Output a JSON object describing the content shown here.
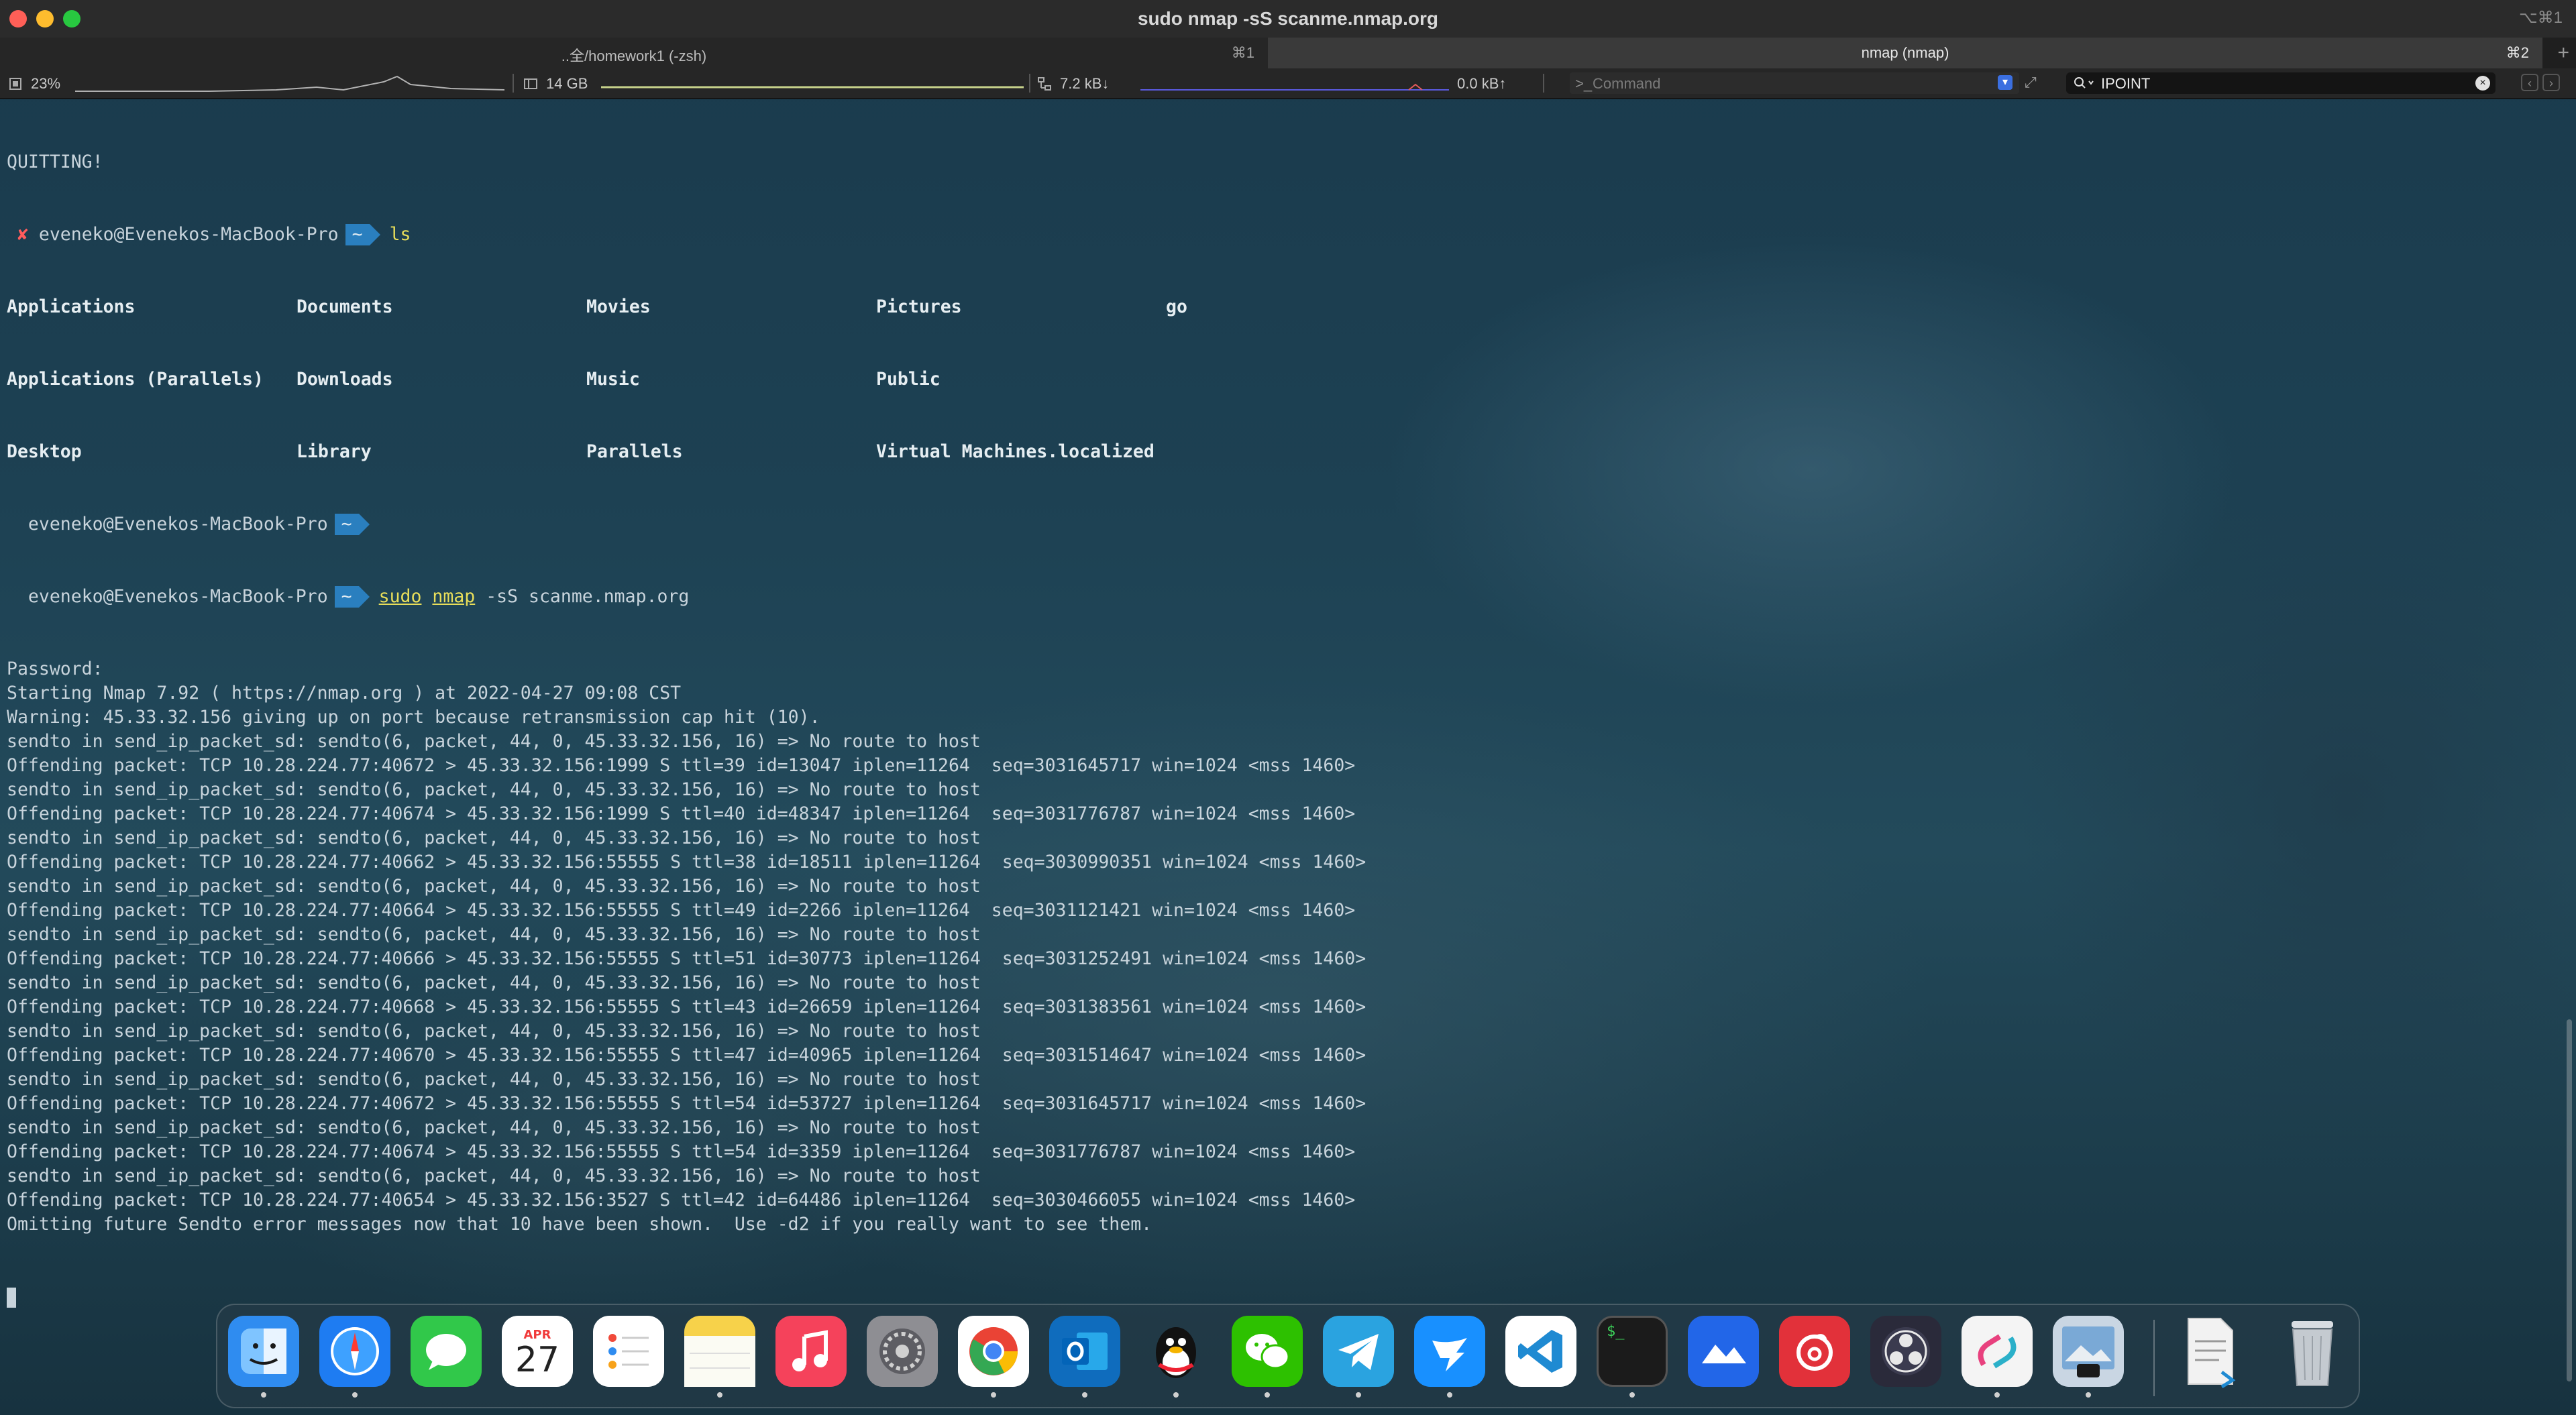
{
  "window": {
    "title": "sudo nmap -sS scanme.nmap.org",
    "shortcut": "⌥⌘1"
  },
  "tabs": [
    {
      "label": "..全/homework1 (-zsh)",
      "shortcut": "⌘1"
    },
    {
      "label": "nmap (nmap)",
      "shortcut": "⌘2"
    }
  ],
  "statusbar": {
    "cpu": "23%",
    "memory": "14 GB",
    "net_down": "7.2 kB↓",
    "net_up": "0.0 kB↑",
    "command_placeholder": "Command",
    "search_value": "IPOINT"
  },
  "terminal": {
    "quitting": "QUITTING!",
    "prompt_user": "eveneko@Evenekos-MacBook-Pro",
    "prompt_dir": "~",
    "cmd_ls": "ls",
    "ls_rows": [
      [
        "Applications",
        "Documents",
        "Movies",
        "Pictures",
        "go"
      ],
      [
        "Applications (Parallels)",
        "Downloads",
        "Music",
        "Public",
        ""
      ],
      [
        "Desktop",
        "Library",
        "Parallels",
        "Virtual Machines.localized",
        ""
      ]
    ],
    "cmd_sudo": "sudo",
    "cmd_nmap": "nmap",
    "cmd_args": " -sS scanme.nmap.org",
    "output": [
      "Password:",
      "Starting Nmap 7.92 ( https://nmap.org ) at 2022-04-27 09:08 CST",
      "Warning: 45.33.32.156 giving up on port because retransmission cap hit (10).",
      "sendto in send_ip_packet_sd: sendto(6, packet, 44, 0, 45.33.32.156, 16) => No route to host",
      "Offending packet: TCP 10.28.224.77:40672 > 45.33.32.156:1999 S ttl=39 id=13047 iplen=11264  seq=3031645717 win=1024 <mss 1460>",
      "sendto in send_ip_packet_sd: sendto(6, packet, 44, 0, 45.33.32.156, 16) => No route to host",
      "Offending packet: TCP 10.28.224.77:40674 > 45.33.32.156:1999 S ttl=40 id=48347 iplen=11264  seq=3031776787 win=1024 <mss 1460>",
      "sendto in send_ip_packet_sd: sendto(6, packet, 44, 0, 45.33.32.156, 16) => No route to host",
      "Offending packet: TCP 10.28.224.77:40662 > 45.33.32.156:55555 S ttl=38 id=18511 iplen=11264  seq=3030990351 win=1024 <mss 1460>",
      "sendto in send_ip_packet_sd: sendto(6, packet, 44, 0, 45.33.32.156, 16) => No route to host",
      "Offending packet: TCP 10.28.224.77:40664 > 45.33.32.156:55555 S ttl=49 id=2266 iplen=11264  seq=3031121421 win=1024 <mss 1460>",
      "sendto in send_ip_packet_sd: sendto(6, packet, 44, 0, 45.33.32.156, 16) => No route to host",
      "Offending packet: TCP 10.28.224.77:40666 > 45.33.32.156:55555 S ttl=51 id=30773 iplen=11264  seq=3031252491 win=1024 <mss 1460>",
      "sendto in send_ip_packet_sd: sendto(6, packet, 44, 0, 45.33.32.156, 16) => No route to host",
      "Offending packet: TCP 10.28.224.77:40668 > 45.33.32.156:55555 S ttl=43 id=26659 iplen=11264  seq=3031383561 win=1024 <mss 1460>",
      "sendto in send_ip_packet_sd: sendto(6, packet, 44, 0, 45.33.32.156, 16) => No route to host",
      "Offending packet: TCP 10.28.224.77:40670 > 45.33.32.156:55555 S ttl=47 id=40965 iplen=11264  seq=3031514647 win=1024 <mss 1460>",
      "sendto in send_ip_packet_sd: sendto(6, packet, 44, 0, 45.33.32.156, 16) => No route to host",
      "Offending packet: TCP 10.28.224.77:40672 > 45.33.32.156:55555 S ttl=54 id=53727 iplen=11264  seq=3031645717 win=1024 <mss 1460>",
      "sendto in send_ip_packet_sd: sendto(6, packet, 44, 0, 45.33.32.156, 16) => No route to host",
      "Offending packet: TCP 10.28.224.77:40674 > 45.33.32.156:55555 S ttl=54 id=3359 iplen=11264  seq=3031776787 win=1024 <mss 1460>",
      "sendto in send_ip_packet_sd: sendto(6, packet, 44, 0, 45.33.32.156, 16) => No route to host",
      "Offending packet: TCP 10.28.224.77:40654 > 45.33.32.156:3527 S ttl=42 id=64486 iplen=11264  seq=3030466055 win=1024 <mss 1460>",
      "Omitting future Sendto error messages now that 10 have been shown.  Use -d2 if you really want to see them."
    ]
  },
  "dock": {
    "calendar_month": "APR",
    "calendar_day": "27",
    "terminal_glyph": "$_",
    "items": [
      {
        "name": "finder-icon",
        "color": "#2f8cf0",
        "running": true
      },
      {
        "name": "safari-icon",
        "color": "#1e7cf2",
        "running": true
      },
      {
        "name": "messages-icon",
        "color": "#31c84a",
        "running": false
      },
      {
        "name": "calendar-icon",
        "color": "#ffffff",
        "running": false
      },
      {
        "name": "reminders-icon",
        "color": "#ffffff",
        "running": false
      },
      {
        "name": "notes-icon",
        "color": "#f7d24a",
        "running": true
      },
      {
        "name": "music-icon",
        "color": "#f5425b",
        "running": false
      },
      {
        "name": "system-preferences-icon",
        "color": "#8e8e93",
        "running": false
      },
      {
        "name": "chrome-icon",
        "color": "#ffffff",
        "running": true
      },
      {
        "name": "outlook-icon",
        "color": "#0f6cbd",
        "running": true
      },
      {
        "name": "qq-icon",
        "color": "#1a1a1a",
        "running": true
      },
      {
        "name": "wechat-icon",
        "color": "#2dc100",
        "running": true
      },
      {
        "name": "telegram-icon",
        "color": "#2aa3e0",
        "running": true
      },
      {
        "name": "dingtalk-icon",
        "color": "#1890ff",
        "running": true
      },
      {
        "name": "vscode-icon",
        "color": "#1f8ad2",
        "running": false
      },
      {
        "name": "terminal-icon",
        "color": "#1b1b1b",
        "running": true
      },
      {
        "name": "lark-icon",
        "color": "#2266e8",
        "running": false
      },
      {
        "name": "netease-music-icon",
        "color": "#e2313a",
        "running": false
      },
      {
        "name": "obs-icon",
        "color": "#2a2a3a",
        "running": false
      },
      {
        "name": "link-app-icon",
        "color": "#f4f4f4",
        "running": true
      },
      {
        "name": "preview-icon",
        "color": "#c9d6e3",
        "running": true
      },
      {
        "name": "document-icon",
        "color": "#f2f2f2",
        "running": false
      },
      {
        "name": "trash-icon",
        "color": "#b9bec4",
        "running": false
      }
    ]
  }
}
